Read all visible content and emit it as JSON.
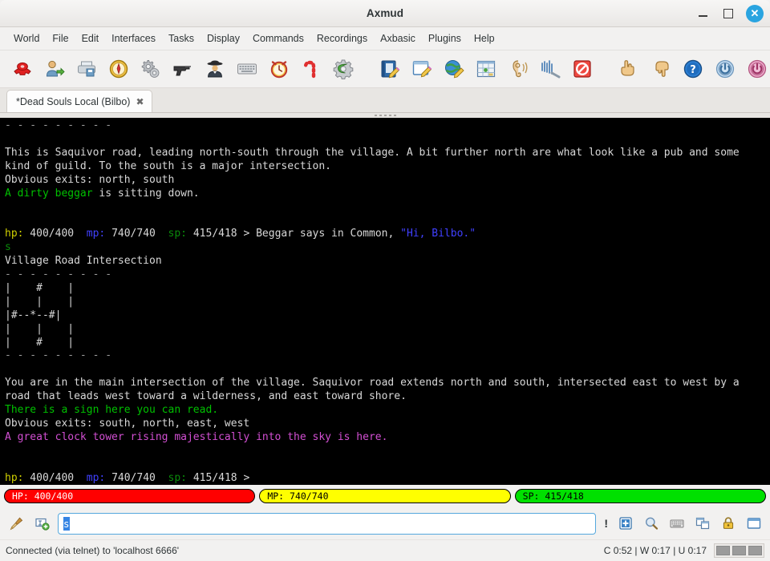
{
  "window": {
    "title": "Axmud",
    "controls": {
      "minimize": "minimize-button",
      "maximize": "maximize-button",
      "close_glyph": "✕"
    }
  },
  "menubar": {
    "items": [
      {
        "label": "World"
      },
      {
        "label": "File"
      },
      {
        "label": "Edit"
      },
      {
        "label": "Interfaces"
      },
      {
        "label": "Tasks"
      },
      {
        "label": "Display"
      },
      {
        "label": "Commands"
      },
      {
        "label": "Recordings"
      },
      {
        "label": "Axbasic"
      },
      {
        "label": "Plugins"
      },
      {
        "label": "Help"
      }
    ]
  },
  "toolbar": {
    "buttons": [
      {
        "name": "connect-telephone-icon",
        "glyph": "☎"
      },
      {
        "name": "login-user-icon",
        "glyph": "👤"
      },
      {
        "name": "save-printer-icon",
        "glyph": "🖨"
      },
      {
        "name": "compass-icon",
        "glyph": "🧭"
      },
      {
        "name": "settings-gears-icon",
        "glyph": "⚙"
      },
      {
        "name": "gun-icon",
        "glyph": "🔫"
      },
      {
        "name": "detective-icon",
        "glyph": "🕵"
      },
      {
        "name": "keyboard-icon",
        "glyph": "⌨"
      },
      {
        "name": "alarm-clock-icon",
        "glyph": "⏰"
      },
      {
        "name": "candy-cane-icon",
        "glyph": "🍬"
      },
      {
        "name": "green-gear-icon",
        "glyph": "⚙"
      },
      {
        "name": "notebook-edit-icon",
        "glyph": "📓"
      },
      {
        "name": "window-edit-icon",
        "glyph": "🗒"
      },
      {
        "name": "globe-edit-icon",
        "glyph": "🌍"
      },
      {
        "name": "map-grid-icon",
        "glyph": "🗺"
      },
      {
        "name": "listen-ear-icon",
        "glyph": "👂"
      },
      {
        "name": "sound-wave-icon",
        "glyph": "🎚"
      },
      {
        "name": "mute-prohibited-icon",
        "glyph": "🚫"
      },
      {
        "name": "hand-up-icon",
        "glyph": "👆"
      },
      {
        "name": "hand-down-icon",
        "glyph": "👇"
      },
      {
        "name": "help-question-icon",
        "glyph": "❓"
      },
      {
        "name": "blue-power-icon",
        "glyph": "⏻"
      },
      {
        "name": "red-power-icon",
        "glyph": "⏻"
      }
    ]
  },
  "tabs": [
    {
      "label": "*Dead Souls Local (Bilbo)",
      "close_glyph": "✖",
      "active": true
    }
  ],
  "terminal": {
    "lines": [
      {
        "segments": [
          {
            "text": "- - - - - - - - -",
            "color": "dim"
          }
        ]
      },
      {
        "segments": [
          {
            "text": "",
            "color": "white"
          }
        ]
      },
      {
        "segments": [
          {
            "text": "This is Saquivor road, leading north-south through the village. A bit further north are what look like a pub and some",
            "color": "white"
          }
        ]
      },
      {
        "segments": [
          {
            "text": "kind of guild. To the south is a major intersection.",
            "color": "white"
          }
        ]
      },
      {
        "segments": [
          {
            "text": "Obvious exits: north, south",
            "color": "white"
          }
        ]
      },
      {
        "segments": [
          {
            "text": "A dirty beggar",
            "color": "green"
          },
          {
            "text": " is sitting down.",
            "color": "white"
          }
        ]
      },
      {
        "segments": [
          {
            "text": "",
            "color": "white"
          }
        ]
      },
      {
        "segments": [
          {
            "text": "",
            "color": "white"
          }
        ]
      },
      {
        "segments": [
          {
            "text": "hp:",
            "color": "yellow"
          },
          {
            "text": " 400/400  ",
            "color": "white"
          },
          {
            "text": "mp:",
            "color": "blue"
          },
          {
            "text": " 740/740  ",
            "color": "white"
          },
          {
            "text": "sp:",
            "color": "dgreen"
          },
          {
            "text": " 415/418 > Beggar says in Common, ",
            "color": "white"
          },
          {
            "text": "\"Hi, Bilbo.\"",
            "color": "blue"
          }
        ]
      },
      {
        "segments": [
          {
            "text": "s",
            "color": "dgreen"
          }
        ]
      },
      {
        "segments": [
          {
            "text": "Village Road Intersection",
            "color": "white"
          }
        ]
      },
      {
        "segments": [
          {
            "text": "- - - - - - - - -",
            "color": "dim"
          }
        ]
      },
      {
        "segments": [
          {
            "text": "|    #    |",
            "color": "white"
          }
        ]
      },
      {
        "segments": [
          {
            "text": "|    |    |",
            "color": "white"
          }
        ]
      },
      {
        "segments": [
          {
            "text": "|#--*--#|",
            "color": "white"
          }
        ]
      },
      {
        "segments": [
          {
            "text": "|    |    |",
            "color": "white"
          }
        ]
      },
      {
        "segments": [
          {
            "text": "|    #    |",
            "color": "white"
          }
        ]
      },
      {
        "segments": [
          {
            "text": "- - - - - - - - -",
            "color": "dim"
          }
        ]
      },
      {
        "segments": [
          {
            "text": "",
            "color": "white"
          }
        ]
      },
      {
        "segments": [
          {
            "text": "You are in the main intersection of the village. Saquivor road extends north and south, intersected east to west by a",
            "color": "white"
          }
        ]
      },
      {
        "segments": [
          {
            "text": "road that leads west toward a wilderness, and east toward shore.",
            "color": "white"
          }
        ]
      },
      {
        "segments": [
          {
            "text": "There is a sign here you can read.",
            "color": "green"
          }
        ]
      },
      {
        "segments": [
          {
            "text": "Obvious exits: south, north, east, west",
            "color": "white"
          }
        ]
      },
      {
        "segments": [
          {
            "text": "A great clock tower rising majestically into the sky is here.",
            "color": "magenta"
          }
        ]
      },
      {
        "segments": [
          {
            "text": "",
            "color": "white"
          }
        ]
      },
      {
        "segments": [
          {
            "text": "",
            "color": "white"
          }
        ]
      },
      {
        "segments": [
          {
            "text": "hp:",
            "color": "yellow"
          },
          {
            "text": " 400/400  ",
            "color": "white"
          },
          {
            "text": "mp:",
            "color": "blue"
          },
          {
            "text": " 740/740  ",
            "color": "white"
          },
          {
            "text": "sp:",
            "color": "dgreen"
          },
          {
            "text": " 415/418 >",
            "color": "white"
          }
        ]
      }
    ]
  },
  "gauges": [
    {
      "name": "hp-gauge",
      "label": "HP: 400/400",
      "fill_color": "#ff0000",
      "text_color": "#ffffff",
      "percent": 100
    },
    {
      "name": "mp-gauge",
      "label": "MP: 740/740",
      "fill_color": "#ffff00",
      "text_color": "#000000",
      "percent": 100
    },
    {
      "name": "sp-gauge",
      "label": "SP: 415/418",
      "fill_color": "#00e000",
      "text_color": "#000000",
      "percent": 99
    }
  ],
  "input": {
    "left_icons": [
      {
        "name": "broom-clear-icon",
        "glyph": "🧹"
      },
      {
        "name": "add-textview-icon",
        "glyph": "🔲"
      }
    ],
    "value": "s",
    "placeholder": "",
    "bang_label": "!",
    "right_icons": [
      {
        "name": "add-plus-icon",
        "glyph": "➕"
      },
      {
        "name": "search-magnifier-icon",
        "glyph": "🔍"
      },
      {
        "name": "keyboard-icon",
        "glyph": "⌨"
      },
      {
        "name": "split-window-icon",
        "glyph": "🗗"
      },
      {
        "name": "lock-icon",
        "glyph": "🔒"
      },
      {
        "name": "window-icon",
        "glyph": "🗖"
      }
    ]
  },
  "statusbar": {
    "connection_text": "Connected (via telnet) to 'localhost 6666'",
    "clocks": "C 0:52 | W 0:17 | U 0:17",
    "indicator_count": 3
  }
}
